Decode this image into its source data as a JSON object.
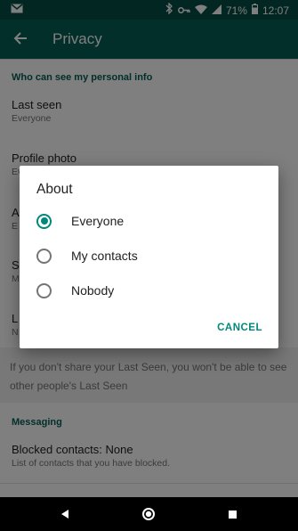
{
  "status_bar": {
    "battery_percent": "71%",
    "time": "12:07",
    "icons": [
      "mail-icon",
      "bluetooth-icon",
      "vpn-key-icon",
      "wifi-icon",
      "cellular-icon",
      "battery-icon"
    ]
  },
  "app_bar": {
    "title": "Privacy",
    "back_icon": "arrow-left-icon"
  },
  "sections": {
    "personal_info": {
      "header": "Who can see my personal info",
      "items": [
        {
          "title": "Last seen",
          "subtitle": "Everyone"
        },
        {
          "title": "Profile photo",
          "subtitle": "Ev"
        },
        {
          "title": "A",
          "subtitle": "E"
        },
        {
          "title": "S",
          "subtitle": "M"
        },
        {
          "title": "L",
          "subtitle": "N"
        }
      ],
      "note": "If you don't share your Last Seen, you won't be able to see other people's Last Seen"
    },
    "messaging": {
      "header": "Messaging",
      "items": [
        {
          "title": "Blocked contacts: None",
          "subtitle": "List of contacts that you have blocked."
        }
      ]
    }
  },
  "dialog": {
    "title": "About",
    "options": [
      {
        "label": "Everyone",
        "selected": true
      },
      {
        "label": "My contacts",
        "selected": false
      },
      {
        "label": "Nobody",
        "selected": false
      }
    ],
    "cancel_label": "CANCEL",
    "accent_color": "#00897b"
  },
  "nav_bar": {
    "icons": [
      "back-triangle-icon",
      "home-circle-icon",
      "recents-square-icon"
    ]
  },
  "colors": {
    "app_bar": "#075e54",
    "status_bar": "#054d44",
    "accent": "#00897b"
  }
}
